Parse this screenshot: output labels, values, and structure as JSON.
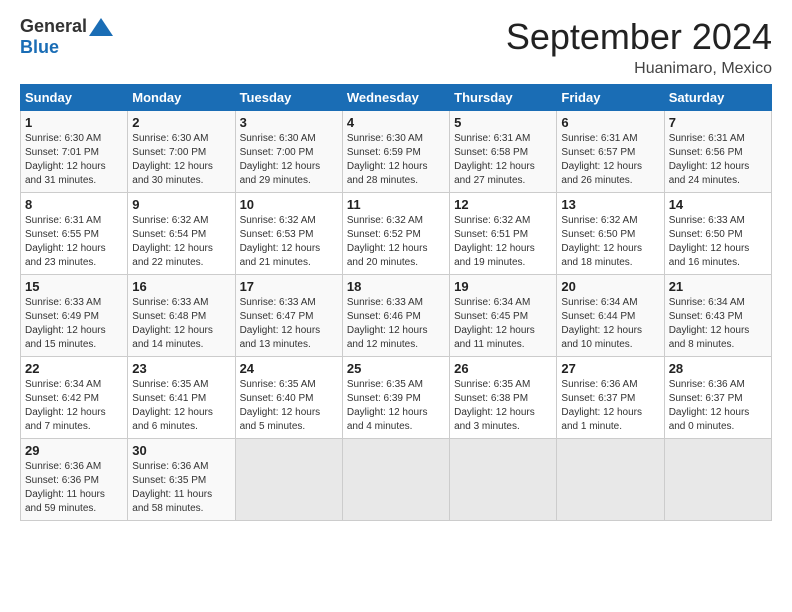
{
  "header": {
    "logo_general": "General",
    "logo_blue": "Blue",
    "month_title": "September 2024",
    "location": "Huanimaro, Mexico"
  },
  "days_of_week": [
    "Sunday",
    "Monday",
    "Tuesday",
    "Wednesday",
    "Thursday",
    "Friday",
    "Saturday"
  ],
  "weeks": [
    [
      {
        "day": "1",
        "info": "Sunrise: 6:30 AM\nSunset: 7:01 PM\nDaylight: 12 hours\nand 31 minutes."
      },
      {
        "day": "2",
        "info": "Sunrise: 6:30 AM\nSunset: 7:00 PM\nDaylight: 12 hours\nand 30 minutes."
      },
      {
        "day": "3",
        "info": "Sunrise: 6:30 AM\nSunset: 7:00 PM\nDaylight: 12 hours\nand 29 minutes."
      },
      {
        "day": "4",
        "info": "Sunrise: 6:30 AM\nSunset: 6:59 PM\nDaylight: 12 hours\nand 28 minutes."
      },
      {
        "day": "5",
        "info": "Sunrise: 6:31 AM\nSunset: 6:58 PM\nDaylight: 12 hours\nand 27 minutes."
      },
      {
        "day": "6",
        "info": "Sunrise: 6:31 AM\nSunset: 6:57 PM\nDaylight: 12 hours\nand 26 minutes."
      },
      {
        "day": "7",
        "info": "Sunrise: 6:31 AM\nSunset: 6:56 PM\nDaylight: 12 hours\nand 24 minutes."
      }
    ],
    [
      {
        "day": "8",
        "info": "Sunrise: 6:31 AM\nSunset: 6:55 PM\nDaylight: 12 hours\nand 23 minutes."
      },
      {
        "day": "9",
        "info": "Sunrise: 6:32 AM\nSunset: 6:54 PM\nDaylight: 12 hours\nand 22 minutes."
      },
      {
        "day": "10",
        "info": "Sunrise: 6:32 AM\nSunset: 6:53 PM\nDaylight: 12 hours\nand 21 minutes."
      },
      {
        "day": "11",
        "info": "Sunrise: 6:32 AM\nSunset: 6:52 PM\nDaylight: 12 hours\nand 20 minutes."
      },
      {
        "day": "12",
        "info": "Sunrise: 6:32 AM\nSunset: 6:51 PM\nDaylight: 12 hours\nand 19 minutes."
      },
      {
        "day": "13",
        "info": "Sunrise: 6:32 AM\nSunset: 6:50 PM\nDaylight: 12 hours\nand 18 minutes."
      },
      {
        "day": "14",
        "info": "Sunrise: 6:33 AM\nSunset: 6:50 PM\nDaylight: 12 hours\nand 16 minutes."
      }
    ],
    [
      {
        "day": "15",
        "info": "Sunrise: 6:33 AM\nSunset: 6:49 PM\nDaylight: 12 hours\nand 15 minutes."
      },
      {
        "day": "16",
        "info": "Sunrise: 6:33 AM\nSunset: 6:48 PM\nDaylight: 12 hours\nand 14 minutes."
      },
      {
        "day": "17",
        "info": "Sunrise: 6:33 AM\nSunset: 6:47 PM\nDaylight: 12 hours\nand 13 minutes."
      },
      {
        "day": "18",
        "info": "Sunrise: 6:33 AM\nSunset: 6:46 PM\nDaylight: 12 hours\nand 12 minutes."
      },
      {
        "day": "19",
        "info": "Sunrise: 6:34 AM\nSunset: 6:45 PM\nDaylight: 12 hours\nand 11 minutes."
      },
      {
        "day": "20",
        "info": "Sunrise: 6:34 AM\nSunset: 6:44 PM\nDaylight: 12 hours\nand 10 minutes."
      },
      {
        "day": "21",
        "info": "Sunrise: 6:34 AM\nSunset: 6:43 PM\nDaylight: 12 hours\nand 8 minutes."
      }
    ],
    [
      {
        "day": "22",
        "info": "Sunrise: 6:34 AM\nSunset: 6:42 PM\nDaylight: 12 hours\nand 7 minutes."
      },
      {
        "day": "23",
        "info": "Sunrise: 6:35 AM\nSunset: 6:41 PM\nDaylight: 12 hours\nand 6 minutes."
      },
      {
        "day": "24",
        "info": "Sunrise: 6:35 AM\nSunset: 6:40 PM\nDaylight: 12 hours\nand 5 minutes."
      },
      {
        "day": "25",
        "info": "Sunrise: 6:35 AM\nSunset: 6:39 PM\nDaylight: 12 hours\nand 4 minutes."
      },
      {
        "day": "26",
        "info": "Sunrise: 6:35 AM\nSunset: 6:38 PM\nDaylight: 12 hours\nand 3 minutes."
      },
      {
        "day": "27",
        "info": "Sunrise: 6:36 AM\nSunset: 6:37 PM\nDaylight: 12 hours\nand 1 minute."
      },
      {
        "day": "28",
        "info": "Sunrise: 6:36 AM\nSunset: 6:37 PM\nDaylight: 12 hours\nand 0 minutes."
      }
    ],
    [
      {
        "day": "29",
        "info": "Sunrise: 6:36 AM\nSunset: 6:36 PM\nDaylight: 11 hours\nand 59 minutes."
      },
      {
        "day": "30",
        "info": "Sunrise: 6:36 AM\nSunset: 6:35 PM\nDaylight: 11 hours\nand 58 minutes."
      },
      {
        "day": "",
        "info": ""
      },
      {
        "day": "",
        "info": ""
      },
      {
        "day": "",
        "info": ""
      },
      {
        "day": "",
        "info": ""
      },
      {
        "day": "",
        "info": ""
      }
    ]
  ]
}
